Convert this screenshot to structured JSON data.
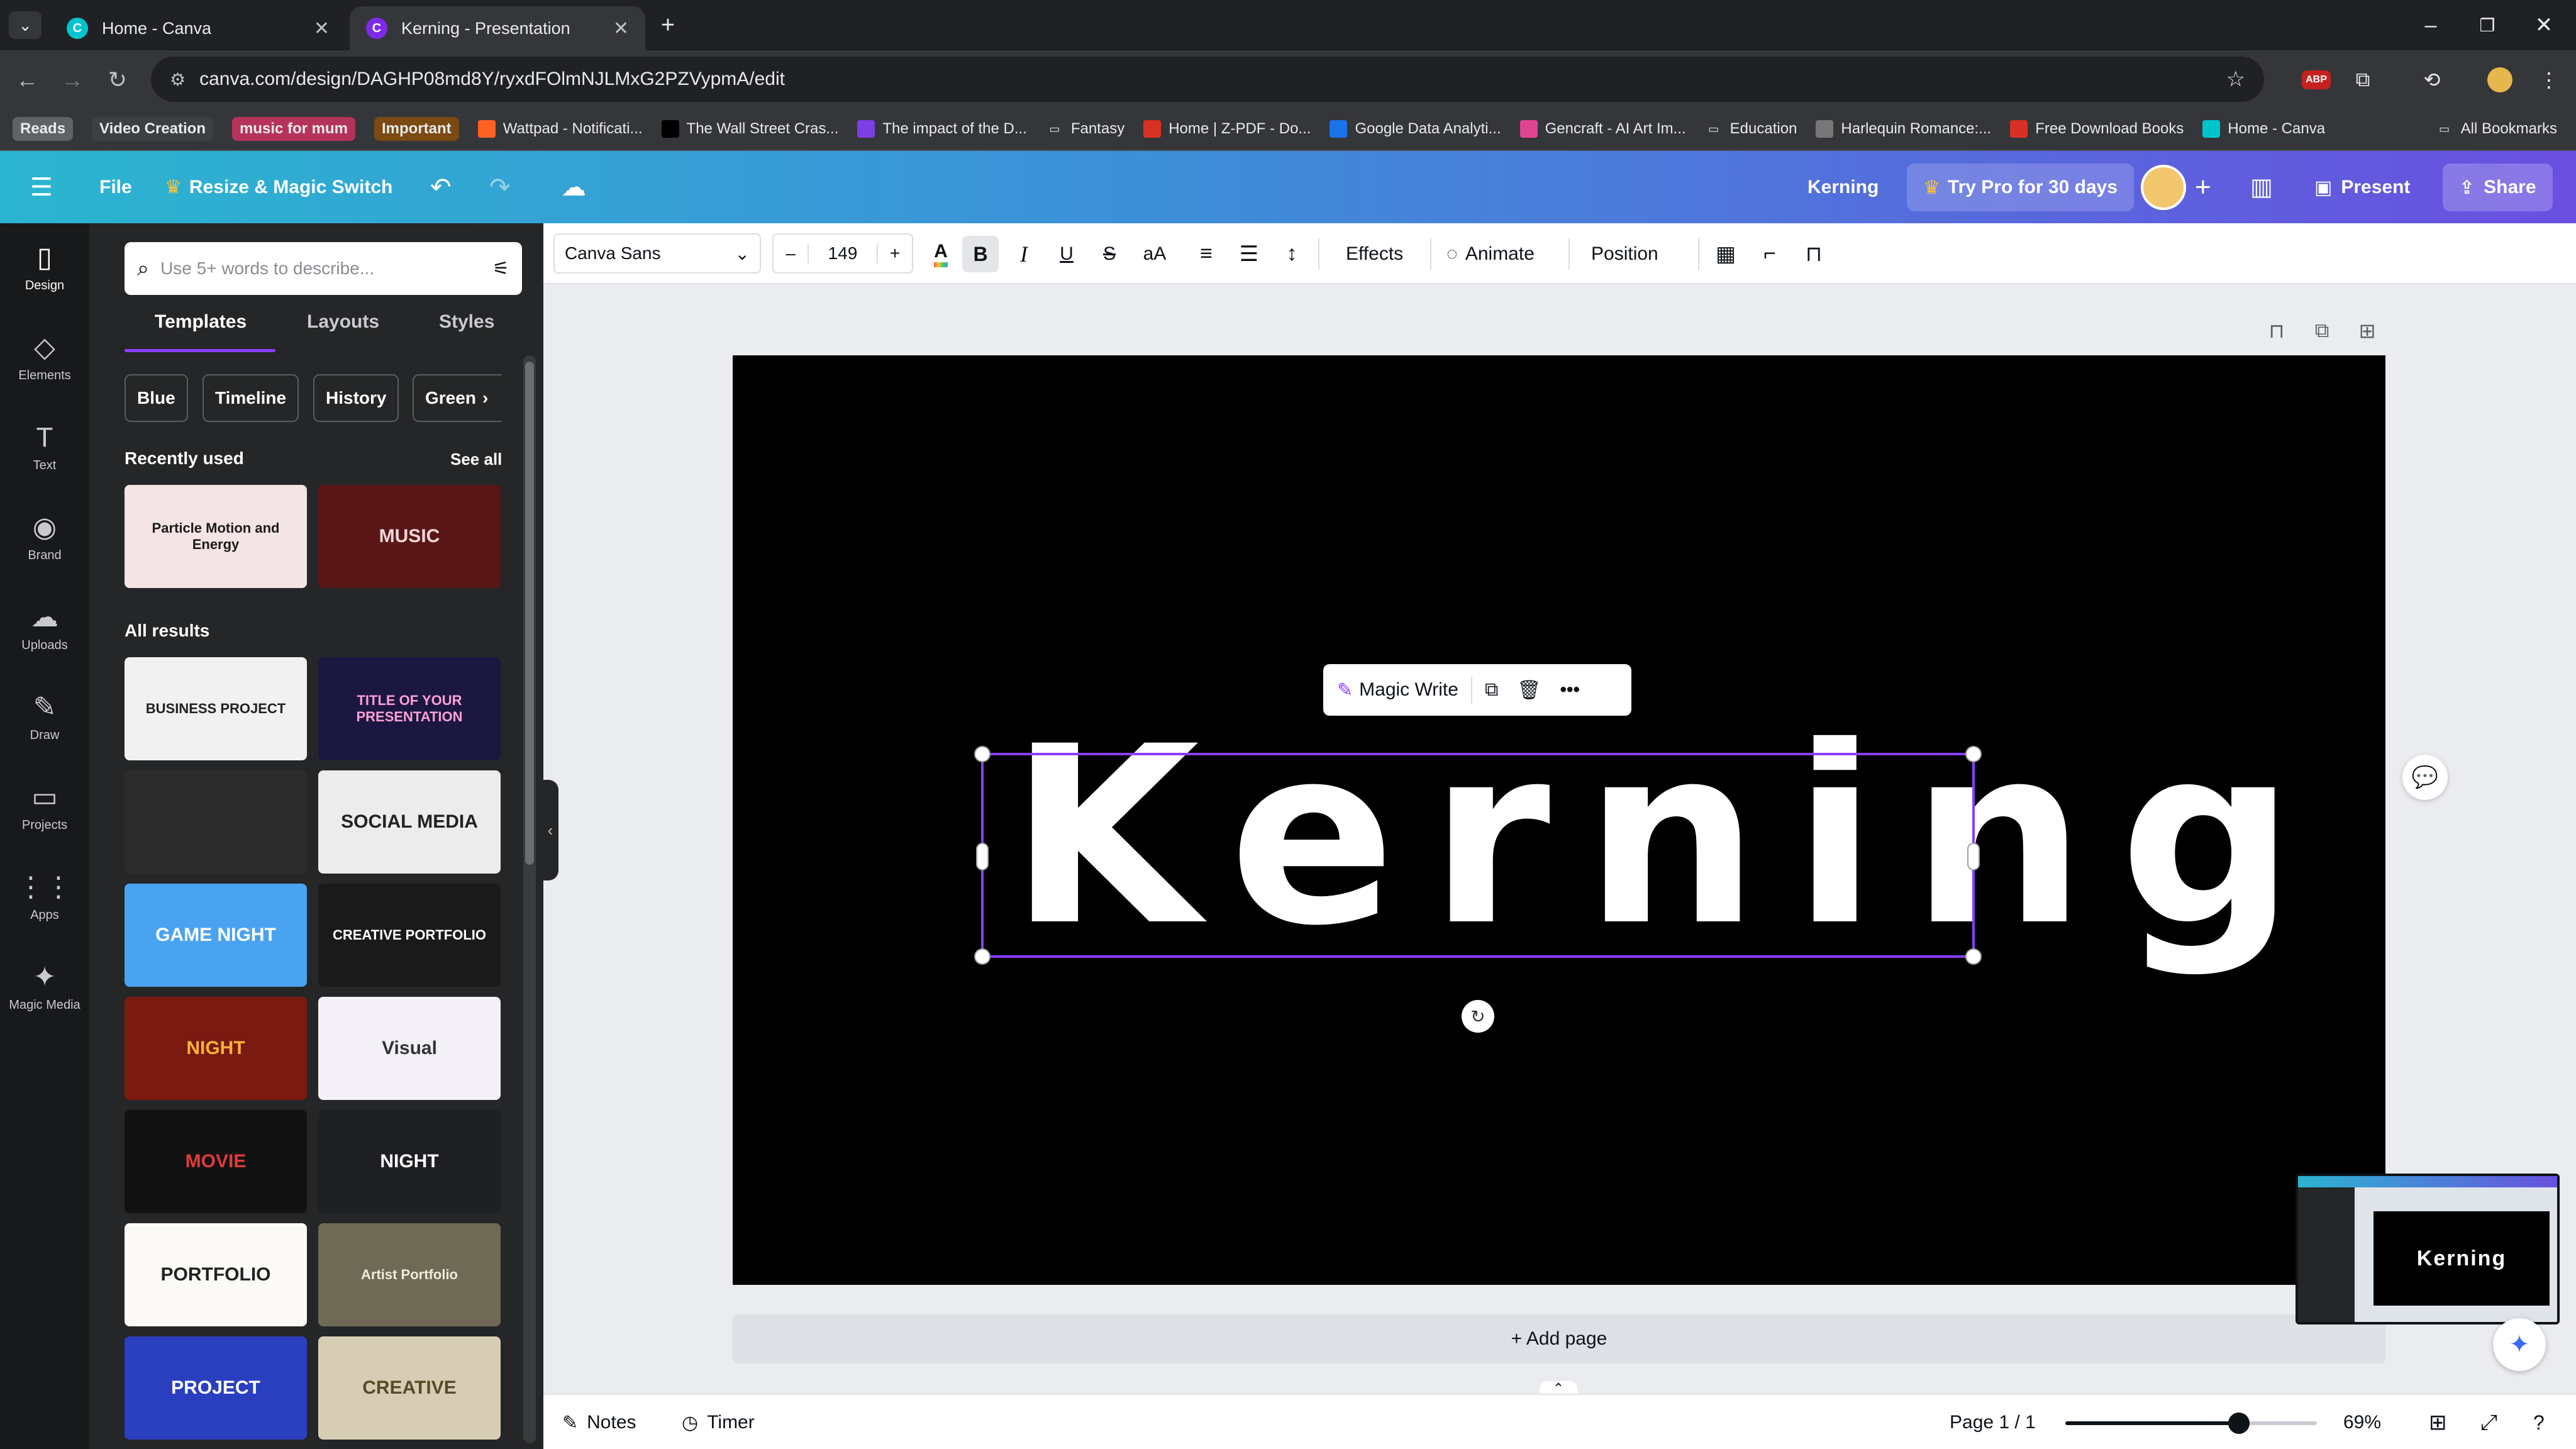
{
  "browser": {
    "tabs": [
      {
        "title": "Home - Canva",
        "active": false
      },
      {
        "title": "Kerning - Presentation",
        "active": true
      }
    ],
    "url": "canva.com/design/DAGHP08md8Y/ryxdFOlmNJLMxG2PZVypmA/edit",
    "bookmarks": [
      {
        "label": "Reads",
        "chip_color": "#5f6368"
      },
      {
        "label": "Video Creation",
        "chip_color": "#3c4043"
      },
      {
        "label": "music for mum",
        "chip_color": "#b5335b"
      },
      {
        "label": "Important",
        "chip_color": "#7a4a12"
      },
      {
        "label": "Wattpad - Notificati...",
        "icon_color": "#ff6122"
      },
      {
        "label": "The Wall Street Cras...",
        "icon_color": "#000000",
        "icon_text": "H"
      },
      {
        "label": "The impact of the D...",
        "icon_color": "#7b3fe4"
      },
      {
        "label": "Fantasy",
        "folder": true
      },
      {
        "label": "Home | Z-PDF - Do...",
        "icon_color": "#d93025"
      },
      {
        "label": "Google Data Analyti...",
        "icon_color": "#1a73e8",
        "icon_text": "C"
      },
      {
        "label": "Gencraft - AI Art Im...",
        "icon_color": "#e04594"
      },
      {
        "label": "Education",
        "folder": true
      },
      {
        "label": "Harlequin Romance:...",
        "icon_color": "#777777"
      },
      {
        "label": "Free Download Books",
        "icon_color": "#d93025"
      },
      {
        "label": "Home - Canva",
        "icon_color": "#00c4cc"
      }
    ],
    "all_bookmarks": "All Bookmarks"
  },
  "header": {
    "file": "File",
    "resize": "Resize & Magic Switch",
    "doc_title": "Kerning",
    "try_pro": "Try Pro for 30 days",
    "present": "Present",
    "share": "Share"
  },
  "rail": [
    {
      "label": "Design",
      "icon": "layout-icon",
      "glyph": "▯"
    },
    {
      "label": "Elements",
      "icon": "shapes-icon",
      "glyph": "◇"
    },
    {
      "label": "Text",
      "icon": "text-icon",
      "glyph": "T"
    },
    {
      "label": "Brand",
      "icon": "brand-icon",
      "glyph": "◉"
    },
    {
      "label": "Uploads",
      "icon": "cloud-upload-icon",
      "glyph": "☁"
    },
    {
      "label": "Draw",
      "icon": "pen-icon",
      "glyph": "✎"
    },
    {
      "label": "Projects",
      "icon": "folder-icon",
      "glyph": "▭"
    },
    {
      "label": "Apps",
      "icon": "grid-icon",
      "glyph": "⋮⋮"
    },
    {
      "label": "Magic Media",
      "icon": "magic-media-icon",
      "glyph": "✦"
    }
  ],
  "panel": {
    "search_placeholder": "Use 5+ words to describe...",
    "tabs": [
      "Templates",
      "Layouts",
      "Styles"
    ],
    "chips": [
      "Blue",
      "Timeline",
      "History",
      "Green"
    ],
    "recently_used": "Recently used",
    "see_all": "See all",
    "all_results": "All results",
    "recent_templates": [
      {
        "title": "Particle Motion and Energy",
        "bg": "#f4e4e6",
        "fg": "#1a1a1a"
      },
      {
        "title": "MUSIC",
        "bg": "#5a1616",
        "fg": "#f3d7d7"
      }
    ],
    "templates": [
      {
        "title": "BUSINESS PROJECT",
        "bg": "#f1f1f1",
        "fg": "#222222"
      },
      {
        "title": "TITLE OF YOUR PRESENTATION",
        "bg": "#1b1740",
        "fg": "#ff9fd6"
      },
      {
        "title": "",
        "bg": "#2b2b2b",
        "fg": "#c0392b"
      },
      {
        "title": "SOCIAL MEDIA",
        "bg": "#ececec",
        "fg": "#222222"
      },
      {
        "title": "GAME NIGHT",
        "bg": "#4aa3f0",
        "fg": "#ffffff"
      },
      {
        "title": "CREATIVE PORTFOLIO",
        "bg": "#1a1a1a",
        "fg": "#ffffff"
      },
      {
        "title": "NIGHT",
        "bg": "#7a1a10",
        "fg": "#f7b23a"
      },
      {
        "title": "Visual",
        "bg": "#f3f1f7",
        "fg": "#333333"
      },
      {
        "title": "MOVIE",
        "bg": "#121212",
        "fg": "#e23b3b"
      },
      {
        "title": "NIGHT",
        "bg": "#1d1f22",
        "fg": "#ffffff"
      },
      {
        "title": "PORTFOLIO",
        "bg": "#fbfaf7",
        "fg": "#222222"
      },
      {
        "title": "Artist Portfolio",
        "bg": "#6f6a55",
        "fg": "#f0ead8"
      },
      {
        "title": "PROJECT",
        "bg": "#2a3fbf",
        "fg": "#ffffff"
      },
      {
        "title": "CREATIVE",
        "bg": "#d7cdb4",
        "fg": "#5a4a2a"
      }
    ]
  },
  "toolbar": {
    "font": "Canva Sans",
    "font_size": "149",
    "effects": "Effects",
    "animate": "Animate",
    "position": "Position"
  },
  "canvas": {
    "text": "Kerning",
    "context_menu": {
      "magic_write": "Magic Write"
    },
    "add_page": "+ Add page"
  },
  "footer": {
    "notes": "Notes",
    "timer": "Timer",
    "page": "Page 1 / 1",
    "zoom": "69%",
    "zoom_fraction": 0.69
  },
  "colors": {
    "accent": "#8b3dff",
    "header_gradient_start": "#2bb5d0",
    "header_gradient_end": "#6a4fe0"
  }
}
